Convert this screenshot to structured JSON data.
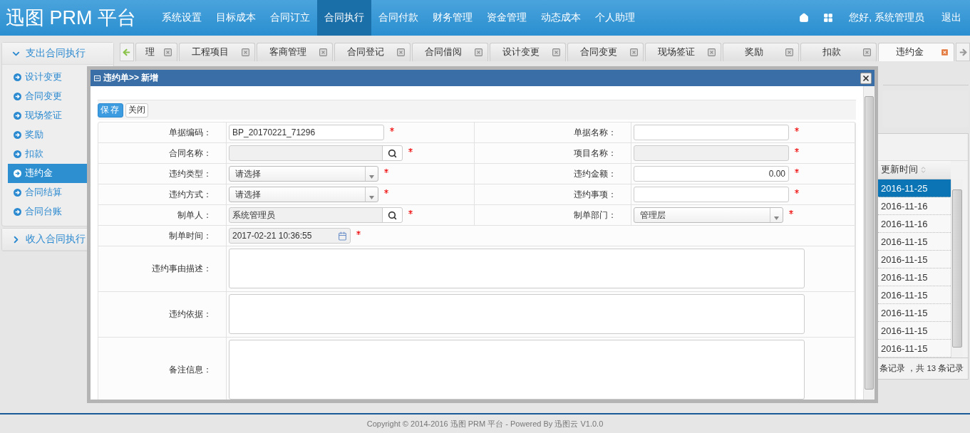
{
  "header": {
    "logo": "迅图 PRM 平台",
    "nav": [
      {
        "label": "系统设置",
        "selected": false
      },
      {
        "label": "目标成本",
        "selected": false
      },
      {
        "label": "合同订立",
        "selected": false
      },
      {
        "label": "合同执行",
        "selected": true
      },
      {
        "label": "合同付款",
        "selected": false
      },
      {
        "label": "财务管理",
        "selected": false
      },
      {
        "label": "资金管理",
        "selected": false
      },
      {
        "label": "动态成本",
        "selected": false
      },
      {
        "label": "个人助理",
        "selected": false
      }
    ],
    "greeting": "您好, 系统管理员",
    "logout": "退出"
  },
  "sidebar": {
    "groups": [
      {
        "title": "支出合同执行",
        "expanded": true,
        "items": [
          {
            "label": "设计变更",
            "selected": false
          },
          {
            "label": "合同变更",
            "selected": false
          },
          {
            "label": "现场签证",
            "selected": false
          },
          {
            "label": "奖励",
            "selected": false
          },
          {
            "label": "扣款",
            "selected": false
          },
          {
            "label": "违约金",
            "selected": true
          },
          {
            "label": "合同结算",
            "selected": false
          },
          {
            "label": "合同台账",
            "selected": false
          }
        ]
      },
      {
        "title": "收入合同执行",
        "expanded": false
      }
    ]
  },
  "tabs": [
    {
      "label": "理",
      "selected": false
    },
    {
      "label": "工程项目",
      "selected": false
    },
    {
      "label": "客商管理",
      "selected": false
    },
    {
      "label": "合同登记",
      "selected": false
    },
    {
      "label": "合同借阅",
      "selected": false
    },
    {
      "label": "设计变更",
      "selected": false
    },
    {
      "label": "合同变更",
      "selected": false
    },
    {
      "label": "现场签证",
      "selected": false
    },
    {
      "label": "奖励",
      "selected": false
    },
    {
      "label": "扣款",
      "selected": false
    },
    {
      "label": "违约金",
      "selected": true
    }
  ],
  "grid": {
    "column": "更新时间",
    "rows": [
      {
        "date": "2016-11-25",
        "selected": true
      },
      {
        "date": "2016-11-16",
        "selected": false
      },
      {
        "date": "2016-11-16",
        "selected": false
      },
      {
        "date": "2016-11-15",
        "selected": false
      },
      {
        "date": "2016-11-15",
        "selected": false
      },
      {
        "date": "2016-11-15",
        "selected": false
      },
      {
        "date": "2016-11-15",
        "selected": false
      },
      {
        "date": "2016-11-15",
        "selected": false
      },
      {
        "date": "2016-11-15",
        "selected": false
      },
      {
        "date": "2016-11-15",
        "selected": false
      }
    ],
    "pager": "条记录 ，共 13 条记录"
  },
  "dialog": {
    "title": "违约单>> 新增",
    "buttons": [
      {
        "label": "保存",
        "kind": "primary"
      },
      {
        "label": "关闭",
        "kind": "default"
      }
    ],
    "rows": [
      {
        "fields": [
          {
            "label": "单据编码：",
            "kind": "text",
            "value": "BP_20170221_71296",
            "disabled": false,
            "required": true
          },
          {
            "label": "单据名称：",
            "kind": "text",
            "disabled": false,
            "required": true
          }
        ]
      },
      {
        "fields": [
          {
            "label": "合同名称：",
            "kind": "lookup",
            "disabled": true,
            "required": true
          },
          {
            "label": "项目名称：",
            "kind": "text",
            "disabled": true,
            "required": true
          }
        ]
      },
      {
        "fields": [
          {
            "label": "违约类型：",
            "kind": "select",
            "value": "请选择",
            "disabled": false,
            "required": true
          },
          {
            "label": "违约金额：",
            "kind": "number",
            "value": "0.00",
            "disabled": false,
            "required": true
          }
        ]
      },
      {
        "fields": [
          {
            "label": "违约方式：",
            "kind": "select",
            "value": "请选择",
            "disabled": false,
            "required": true
          },
          {
            "label": "违约事项：",
            "kind": "text",
            "disabled": false,
            "required": true
          }
        ]
      },
      {
        "fields": [
          {
            "label": "制单人：",
            "kind": "lookup",
            "value": "系统管理员",
            "disabled": true,
            "required": true
          },
          {
            "label": "制单部门：",
            "kind": "select",
            "value": "管理层",
            "disabled": false,
            "required": true
          }
        ]
      },
      {
        "fields": [
          {
            "label": "制单时间：",
            "kind": "date",
            "value": "2017-02-21 10:36:55",
            "disabled": true,
            "required": true
          }
        ]
      },
      {
        "fields": [
          {
            "label": "违约事由描述：",
            "kind": "textarea",
            "disabled": false
          }
        ]
      },
      {
        "fields": [
          {
            "label": "违约依据：",
            "kind": "textarea",
            "disabled": false
          }
        ]
      },
      {
        "fields": [
          {
            "label": "备注信息：",
            "kind": "textarea",
            "disabled": false
          }
        ]
      }
    ]
  },
  "footer": "Copyright © 2014-2016 迅图 PRM 平台 - Powered By 迅图云 V1.0.0"
}
